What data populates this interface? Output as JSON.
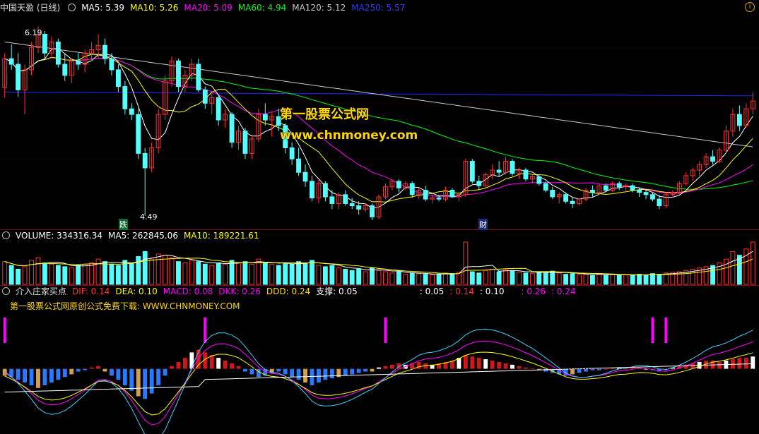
{
  "main_legend": {
    "title": "中国天盈 (日线)",
    "ma5": "MA5: 5.39",
    "ma10": "MA10: 5.26",
    "ma20": "MA20: 5.09",
    "ma60": "MA60: 4.94",
    "ma120": "MA120: 5.12",
    "ma250": "MA250: 5.57"
  },
  "volume_legend": {
    "volume": "VOLUME: 334316.34",
    "ma5": "MA5: 262845.06",
    "ma10": "MA10: 189221.61"
  },
  "indicator_legend": {
    "name": "介入庄家买点",
    "dif": "DIF: 0.14",
    "dea": "DEA: 0.10",
    "macd": "MACD: 0.08",
    "dkk": "DKK: 0.26",
    "ddd": "DDD: 0.24",
    "support": "支撑: 0.05",
    "v1": ": 0.05",
    "v2": ": 0.14",
    "v3": ": 0.10",
    "v4": ": 0.26",
    "v5": ": 0.24"
  },
  "indicator_note": "第一股票公式网原创公式免费下载: WWW.CHNMONEY.COM",
  "watermark": {
    "line1": "第一股票公式网",
    "line2": "www.chnmoney.com"
  },
  "markers": {
    "high_label": "6.19",
    "low_label": "4.49",
    "fall_mark": "跌",
    "wealth_mark": "财"
  },
  "colors": {
    "up": "#ff3232",
    "down": "#54ffff",
    "ma5": "#ffffff",
    "ma10": "#ffff00",
    "ma20": "#ff00ff",
    "ma60": "#00ff00",
    "ma120": "#c8c8c8",
    "ma250": "#2424ff"
  },
  "chart_data": {
    "type": "candlestick",
    "price_range": [
      4.4,
      6.3
    ],
    "ohlc": [
      [
        5.64,
        5.95,
        5.55,
        5.9
      ],
      [
        5.9,
        6.03,
        5.8,
        5.85
      ],
      [
        5.85,
        5.95,
        5.56,
        5.62
      ],
      [
        5.62,
        5.85,
        5.4,
        5.8
      ],
      [
        5.8,
        6.05,
        5.75,
        6.0
      ],
      [
        6.0,
        6.19,
        5.95,
        6.12
      ],
      [
        6.12,
        6.15,
        5.9,
        5.95
      ],
      [
        5.95,
        6.1,
        5.9,
        6.05
      ],
      [
        6.05,
        6.08,
        5.82,
        5.85
      ],
      [
        5.85,
        5.95,
        5.7,
        5.75
      ],
      [
        5.75,
        5.9,
        5.68,
        5.88
      ],
      [
        5.88,
        5.95,
        5.8,
        5.85
      ],
      [
        5.85,
        5.98,
        5.78,
        5.95
      ],
      [
        5.95,
        6.05,
        5.88,
        5.98
      ],
      [
        5.98,
        6.12,
        5.9,
        6.02
      ],
      [
        6.02,
        6.08,
        5.85,
        5.9
      ],
      [
        5.9,
        5.95,
        5.75,
        5.8
      ],
      [
        5.8,
        5.85,
        5.6,
        5.65
      ],
      [
        5.65,
        5.7,
        5.4,
        5.45
      ],
      [
        5.45,
        5.5,
        5.35,
        5.4
      ],
      [
        5.4,
        5.45,
        5.0,
        5.05
      ],
      [
        5.05,
        5.1,
        4.49,
        4.92
      ],
      [
        4.92,
        5.15,
        4.88,
        5.1
      ],
      [
        5.1,
        5.45,
        5.05,
        5.4
      ],
      [
        5.4,
        5.75,
        5.35,
        5.7
      ],
      [
        5.7,
        5.92,
        5.65,
        5.88
      ],
      [
        5.88,
        5.9,
        5.6,
        5.65
      ],
      [
        5.65,
        5.8,
        5.6,
        5.75
      ],
      [
        5.75,
        5.9,
        5.7,
        5.85
      ],
      [
        5.85,
        5.9,
        5.6,
        5.62
      ],
      [
        5.62,
        5.65,
        5.45,
        5.5
      ],
      [
        5.5,
        5.6,
        5.4,
        5.55
      ],
      [
        5.55,
        5.58,
        5.3,
        5.35
      ],
      [
        5.35,
        5.45,
        5.28,
        5.4
      ],
      [
        5.4,
        5.42,
        5.1,
        5.15
      ],
      [
        5.15,
        5.3,
        5.08,
        5.25
      ],
      [
        5.25,
        5.28,
        5.0,
        5.05
      ],
      [
        5.05,
        5.2,
        5.0,
        5.18
      ],
      [
        5.18,
        5.45,
        5.15,
        5.4
      ],
      [
        5.4,
        5.5,
        5.3,
        5.35
      ],
      [
        5.35,
        5.42,
        5.2,
        5.38
      ],
      [
        5.38,
        5.45,
        5.25,
        5.3
      ],
      [
        5.3,
        5.32,
        5.05,
        5.1
      ],
      [
        5.1,
        5.15,
        4.95,
        5.0
      ],
      [
        5.0,
        5.1,
        4.85,
        4.88
      ],
      [
        4.88,
        4.95,
        4.75,
        4.8
      ],
      [
        4.8,
        4.85,
        4.62,
        4.65
      ],
      [
        4.65,
        4.82,
        4.6,
        4.78
      ],
      [
        4.78,
        4.8,
        4.62,
        4.66
      ],
      [
        4.66,
        4.72,
        4.55,
        4.6
      ],
      [
        4.6,
        4.7,
        4.55,
        4.68
      ],
      [
        4.68,
        4.72,
        4.58,
        4.6
      ],
      [
        4.6,
        4.65,
        4.55,
        4.58
      ],
      [
        4.58,
        4.62,
        4.5,
        4.55
      ],
      [
        4.55,
        4.6,
        4.52,
        4.58
      ],
      [
        4.58,
        4.6,
        4.45,
        4.48
      ],
      [
        4.48,
        4.68,
        4.46,
        4.66
      ],
      [
        4.66,
        4.78,
        4.64,
        4.75
      ],
      [
        4.75,
        4.82,
        4.72,
        4.8
      ],
      [
        4.8,
        4.82,
        4.7,
        4.74
      ],
      [
        4.74,
        4.8,
        4.72,
        4.78
      ],
      [
        4.78,
        4.8,
        4.65,
        4.68
      ],
      [
        4.68,
        4.74,
        4.64,
        4.72
      ],
      [
        4.72,
        4.76,
        4.62,
        4.64
      ],
      [
        4.64,
        4.68,
        4.6,
        4.65
      ],
      [
        4.65,
        4.68,
        4.62,
        4.64
      ],
      [
        4.64,
        4.75,
        4.62,
        4.72
      ],
      [
        4.72,
        4.74,
        4.65,
        4.66
      ],
      [
        4.66,
        4.7,
        4.62,
        4.68
      ],
      [
        4.68,
        5.0,
        4.66,
        4.98
      ],
      [
        4.98,
        5.0,
        4.78,
        4.8
      ],
      [
        4.8,
        4.85,
        4.72,
        4.76
      ],
      [
        4.76,
        4.88,
        4.74,
        4.86
      ],
      [
        4.86,
        4.95,
        4.82,
        4.9
      ],
      [
        4.9,
        4.98,
        4.84,
        4.88
      ],
      [
        4.88,
        5.02,
        4.86,
        4.98
      ],
      [
        4.98,
        5.0,
        4.85,
        4.87
      ],
      [
        4.87,
        4.92,
        4.82,
        4.9
      ],
      [
        4.9,
        4.92,
        4.8,
        4.82
      ],
      [
        4.82,
        4.86,
        4.78,
        4.84
      ],
      [
        4.84,
        4.86,
        4.76,
        4.78
      ],
      [
        4.78,
        4.8,
        4.7,
        4.72
      ],
      [
        4.72,
        4.75,
        4.64,
        4.66
      ],
      [
        4.66,
        4.7,
        4.6,
        4.68
      ],
      [
        4.68,
        4.7,
        4.6,
        4.62
      ],
      [
        4.62,
        4.66,
        4.56,
        4.6
      ],
      [
        4.6,
        4.65,
        4.58,
        4.64
      ],
      [
        4.64,
        4.74,
        4.62,
        4.72
      ],
      [
        4.72,
        4.76,
        4.66,
        4.7
      ],
      [
        4.7,
        4.78,
        4.68,
        4.76
      ],
      [
        4.76,
        4.78,
        4.7,
        4.72
      ],
      [
        4.72,
        4.8,
        4.7,
        4.78
      ],
      [
        4.78,
        4.8,
        4.72,
        4.75
      ],
      [
        4.75,
        4.78,
        4.7,
        4.76
      ],
      [
        4.76,
        4.78,
        4.7,
        4.72
      ],
      [
        4.72,
        4.74,
        4.66,
        4.7
      ],
      [
        4.7,
        4.72,
        4.64,
        4.68
      ],
      [
        4.68,
        4.7,
        4.62,
        4.64
      ],
      [
        4.64,
        4.68,
        4.55,
        4.58
      ],
      [
        4.58,
        4.7,
        4.56,
        4.68
      ],
      [
        4.68,
        4.72,
        4.65,
        4.7
      ],
      [
        4.7,
        4.8,
        4.68,
        4.78
      ],
      [
        4.78,
        4.88,
        4.76,
        4.85
      ],
      [
        4.85,
        4.92,
        4.8,
        4.9
      ],
      [
        4.9,
        4.98,
        4.85,
        4.95
      ],
      [
        4.95,
        5.05,
        4.92,
        5.02
      ],
      [
        5.02,
        5.08,
        4.95,
        4.98
      ],
      [
        4.98,
        5.1,
        4.96,
        5.08
      ],
      [
        5.08,
        5.3,
        5.05,
        5.25
      ],
      [
        5.25,
        5.45,
        5.2,
        5.4
      ],
      [
        5.4,
        5.48,
        5.25,
        5.3
      ],
      [
        5.3,
        5.5,
        5.28,
        5.45
      ],
      [
        5.45,
        5.6,
        5.4,
        5.52
      ]
    ],
    "volume_range": [
      0,
      340000
    ],
    "volume": [
      180000,
      150000,
      120000,
      140000,
      190000,
      210000,
      170000,
      160000,
      150000,
      140000,
      130000,
      150000,
      160000,
      170000,
      200000,
      180000,
      160000,
      150000,
      190000,
      170000,
      220000,
      260000,
      200000,
      240000,
      230000,
      210000,
      180000,
      170000,
      190000,
      180000,
      160000,
      150000,
      170000,
      160000,
      190000,
      170000,
      180000,
      160000,
      200000,
      170000,
      160000,
      150000,
      170000,
      160000,
      180000,
      170000,
      190000,
      150000,
      140000,
      150000,
      130000,
      120000,
      110000,
      120000,
      100000,
      130000,
      110000,
      100000,
      90000,
      100000,
      80000,
      90000,
      85000,
      80000,
      75000,
      80000,
      90000,
      85000,
      95000,
      334316,
      100000,
      90000,
      110000,
      120000,
      100000,
      115000,
      105000,
      95000,
      90000,
      85000,
      100000,
      95000,
      105000,
      90000,
      80000,
      85000,
      75000,
      80000,
      70000,
      85000,
      75000,
      80000,
      70000,
      75000,
      70000,
      80000,
      75000,
      85000,
      80000,
      90000,
      95000,
      100000,
      110000,
      120000,
      130000,
      140000,
      150000,
      170000,
      200000,
      260000,
      230000,
      280000,
      334316
    ],
    "indicator_range": [
      -0.45,
      0.4
    ],
    "macd_hist": [
      -0.05,
      -0.06,
      -0.08,
      -0.1,
      -0.12,
      -0.14,
      -0.12,
      -0.1,
      -0.08,
      -0.06,
      -0.04,
      -0.02,
      -0.01,
      0.01,
      0.02,
      -0.02,
      -0.05,
      -0.08,
      -0.12,
      -0.16,
      -0.2,
      -0.22,
      -0.18,
      -0.12,
      -0.05,
      0.02,
      0.05,
      0.08,
      0.12,
      0.14,
      0.12,
      0.1,
      0.08,
      0.06,
      0.04,
      0.02,
      -0.02,
      -0.04,
      -0.06,
      -0.05,
      -0.03,
      -0.02,
      -0.04,
      -0.06,
      -0.08,
      -0.1,
      -0.12,
      -0.1,
      -0.08,
      -0.07,
      -0.06,
      -0.05,
      -0.04,
      -0.03,
      -0.02,
      -0.02,
      0.01,
      0.02,
      0.03,
      0.04,
      0.03,
      0.04,
      0.05,
      0.04,
      0.03,
      0.04,
      0.05,
      0.06,
      0.08,
      0.1,
      0.09,
      0.08,
      0.07,
      0.06,
      0.05,
      0.04,
      0.03,
      0.02,
      0.01,
      0.005,
      -0.01,
      -0.02,
      -0.03,
      -0.04,
      -0.05,
      -0.04,
      -0.03,
      -0.02,
      -0.01,
      -0.01,
      0.0,
      0.01,
      0.01,
      0.0,
      0.01,
      0.01,
      0.0,
      -0.01,
      -0.02,
      -0.01,
      0.01,
      0.02,
      0.03,
      0.04,
      0.05,
      0.06,
      0.06,
      0.05,
      0.06,
      0.07,
      0.08,
      0.08,
      0.09
    ],
    "buy_signals": [
      0,
      30,
      57,
      97,
      99
    ]
  }
}
